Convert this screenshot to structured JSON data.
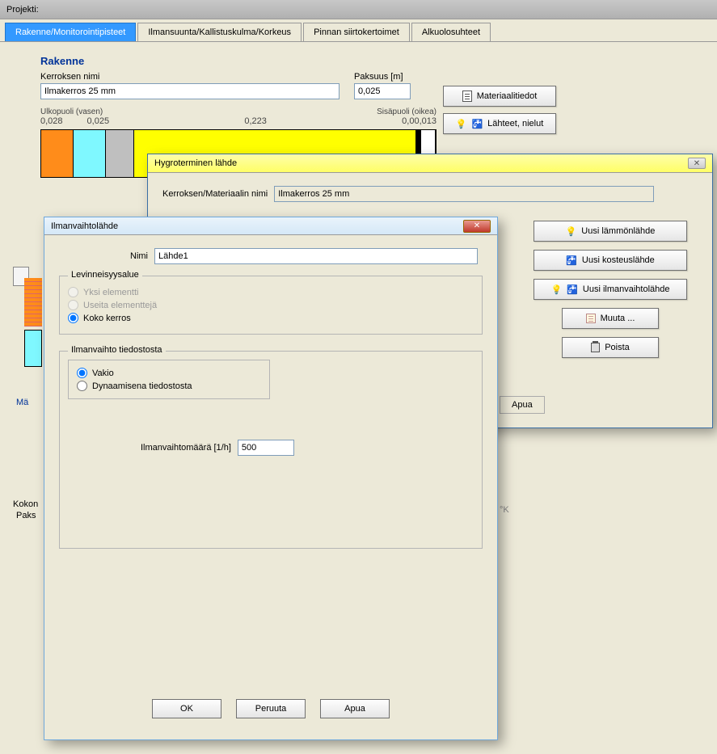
{
  "titlebar": "Projekti:",
  "tabs": {
    "active": "Rakenne/Monitorointipisteet",
    "t2": "Ilmansuunta/Kallistuskulma/Korkeus",
    "t3": "Pinnan siirtokertoimet",
    "t4": "Alkuolosuhteet"
  },
  "section": {
    "title": "Rakenne",
    "layer_name_label": "Kerroksen nimi",
    "layer_name_value": "Ilmakerros 25 mm",
    "thickness_label": "Paksuus [m]",
    "thickness_value": "0,025",
    "btn_material": "Materiaalitiedot",
    "btn_sources": "Lähteet, nielut",
    "outside_label": "Ulkopuoli (vasen)",
    "inside_label": "Sisäpuoli (oikea)",
    "scale_1": "0,028",
    "scale_2": "0,025",
    "scale_mid": "0,223",
    "scale_r": "0,00,013"
  },
  "hygro": {
    "title": "Hygroterminen lähde",
    "field_label": "Kerroksen/Materiaalin nimi",
    "field_value": "Ilmakerros 25 mm",
    "btn_heat": "Uusi lämmönlähde",
    "btn_moist": "Uusi kosteuslähde",
    "btn_air": "Uusi ilmanvaihtolähde",
    "btn_edit": "Muuta ...",
    "btn_delete": "Poista",
    "btn_help": "Apua"
  },
  "air_dlg": {
    "title": "Ilmanvaihtolähde",
    "name_label": "Nimi",
    "name_value": "Lähde1",
    "group1": "Levinneisyysalue",
    "r1": "Yksi elementti",
    "r2": "Useita elementtejä",
    "r3": "Koko kerros",
    "group2": "Ilmanvaihto tiedostosta",
    "r4": "Vakio",
    "r5": "Dynaamisena tiedostosta",
    "rate_label": "Ilmanvaihtomäärä [1/h]",
    "rate_value": "500",
    "ok": "OK",
    "cancel": "Peruuta",
    "help": "Apua"
  },
  "hidden": {
    "left1": "Mä",
    "left2": "Kokon",
    "left3": "Paks",
    "right1": "Apua",
    "right2": "°K"
  }
}
